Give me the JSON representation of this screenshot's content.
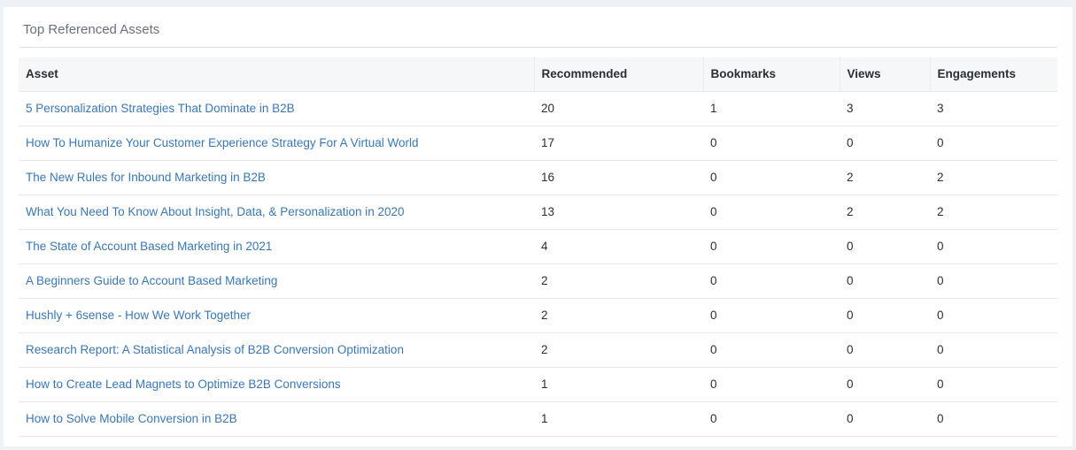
{
  "panel": {
    "title": "Top Referenced Assets"
  },
  "table": {
    "headers": {
      "asset": "Asset",
      "recommended": "Recommended",
      "bookmarks": "Bookmarks",
      "views": "Views",
      "engagements": "Engagements"
    },
    "rows": [
      {
        "asset": "5 Personalization Strategies That Dominate in B2B",
        "recommended": "20",
        "bookmarks": "1",
        "views": "3",
        "engagements": "3"
      },
      {
        "asset": "How To Humanize Your Customer Experience Strategy For A Virtual World",
        "recommended": "17",
        "bookmarks": "0",
        "views": "0",
        "engagements": "0"
      },
      {
        "asset": "The New Rules for Inbound Marketing in B2B",
        "recommended": "16",
        "bookmarks": "0",
        "views": "2",
        "engagements": "2"
      },
      {
        "asset": "What You Need To Know About Insight, Data, & Personalization in 2020",
        "recommended": "13",
        "bookmarks": "0",
        "views": "2",
        "engagements": "2"
      },
      {
        "asset": "The State of Account Based Marketing in 2021",
        "recommended": "4",
        "bookmarks": "0",
        "views": "0",
        "engagements": "0"
      },
      {
        "asset": "A Beginners Guide to Account Based Marketing",
        "recommended": "2",
        "bookmarks": "0",
        "views": "0",
        "engagements": "0"
      },
      {
        "asset": "Hushly + 6sense - How We Work Together",
        "recommended": "2",
        "bookmarks": "0",
        "views": "0",
        "engagements": "0"
      },
      {
        "asset": "Research Report: A Statistical Analysis of B2B Conversion Optimization",
        "recommended": "2",
        "bookmarks": "0",
        "views": "0",
        "engagements": "0"
      },
      {
        "asset": "How to Create Lead Magnets to Optimize B2B Conversions",
        "recommended": "1",
        "bookmarks": "0",
        "views": "0",
        "engagements": "0"
      },
      {
        "asset": "How to Solve Mobile Conversion in B2B",
        "recommended": "1",
        "bookmarks": "0",
        "views": "0",
        "engagements": "0"
      }
    ]
  },
  "colors": {
    "link": "#3a78b5",
    "header_bg": "#f6f7f8",
    "page_bg": "#eef1f5"
  }
}
